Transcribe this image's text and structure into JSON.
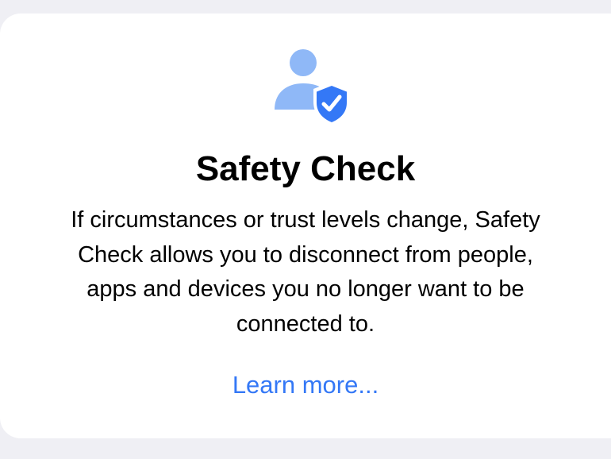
{
  "card": {
    "icon": "person-with-shield-checkmark-icon",
    "title": "Safety Check",
    "description_lines": [
      "If circumstances or trust levels change, Safety",
      "Check allows you to disconnect from people,",
      "apps and devices you no longer want to be",
      "connected to."
    ],
    "learn_more": "Learn more..."
  },
  "colors": {
    "background": "#efeff4",
    "card": "#ffffff",
    "person_icon": "#8fb8f7",
    "shield_icon": "#3478f6",
    "link": "#3478f6",
    "text": "#000000"
  }
}
